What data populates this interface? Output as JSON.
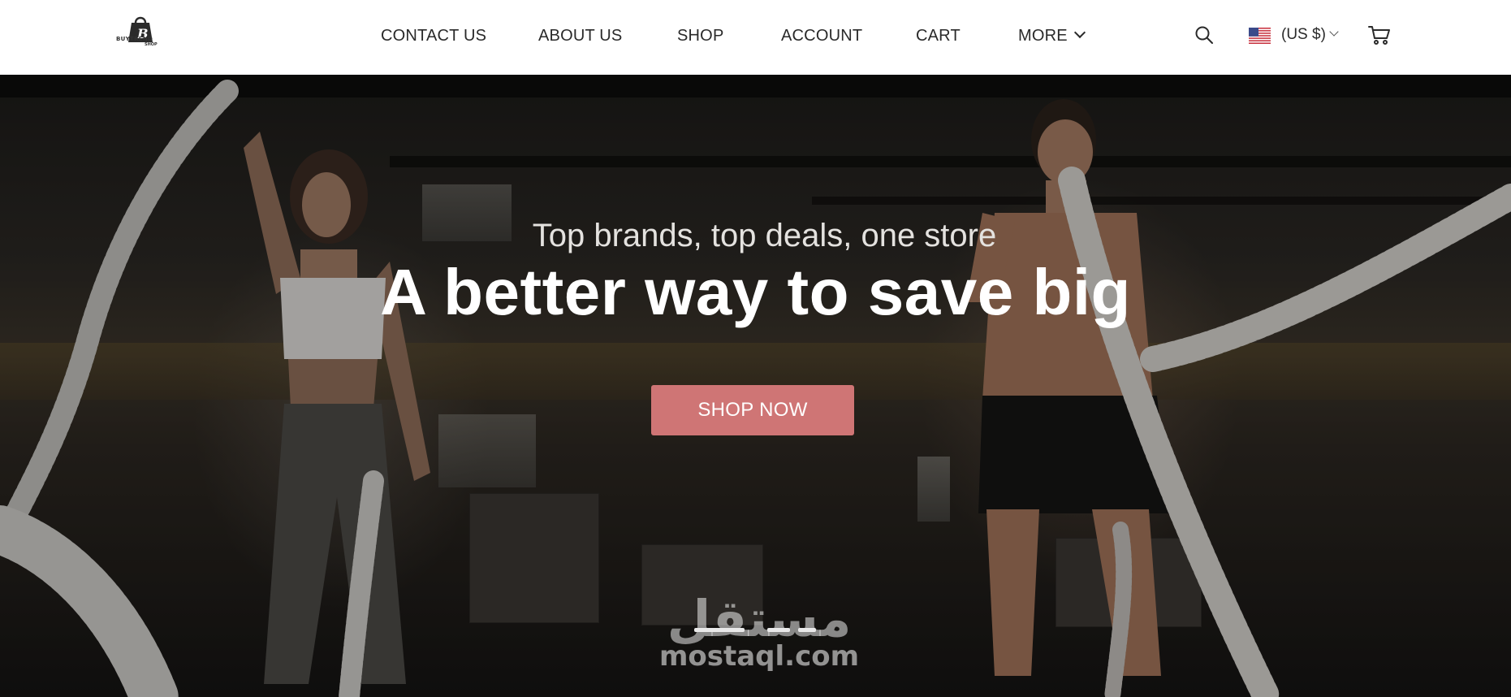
{
  "brand": {
    "name": "BUYTREND",
    "sub": "SHOP"
  },
  "nav": {
    "items": [
      {
        "label": "CONTACT US"
      },
      {
        "label": "ABOUT US"
      },
      {
        "label": "SHOP"
      },
      {
        "label": "ACCOUNT"
      },
      {
        "label": "CART"
      },
      {
        "label": "MORE"
      }
    ]
  },
  "header": {
    "currency": "(US $)"
  },
  "hero": {
    "subtitle": "Top brands, top deals, one store",
    "title": "A better way to save big",
    "cta_label": "SHOP NOW",
    "slides_total": 3,
    "active_slide": 1
  },
  "watermark": {
    "arabic": "مستقل",
    "latin": "mostaql.com"
  },
  "colors": {
    "accent": "#cf7575",
    "header_bg": "#ffffff",
    "nav_text": "#2a2a2a"
  }
}
